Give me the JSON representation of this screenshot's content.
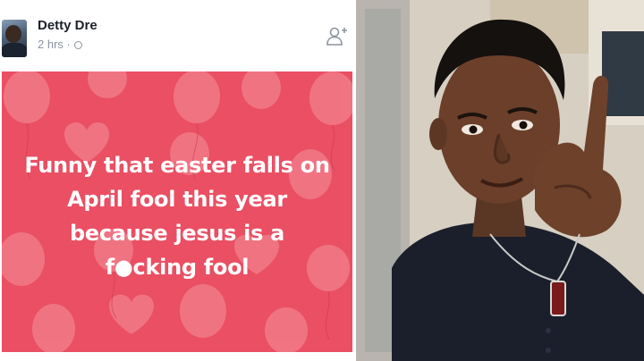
{
  "post": {
    "author": "Detty Dre",
    "time": "2 hrs ·",
    "icons": {
      "avatar": "profile-photo",
      "privacy": "globe-icon",
      "add_friend": "add-friend-icon"
    },
    "image_text": {
      "line1": "Funny that easter falls on",
      "line2": "April fool this year",
      "line3": "because jesus is a",
      "line4": "f●cking fool"
    },
    "colors": {
      "background": "#ea4f63",
      "balloons": "#f27a88",
      "text": "#ffffff"
    }
  },
  "photo": {
    "subject": "selfie-photo"
  }
}
